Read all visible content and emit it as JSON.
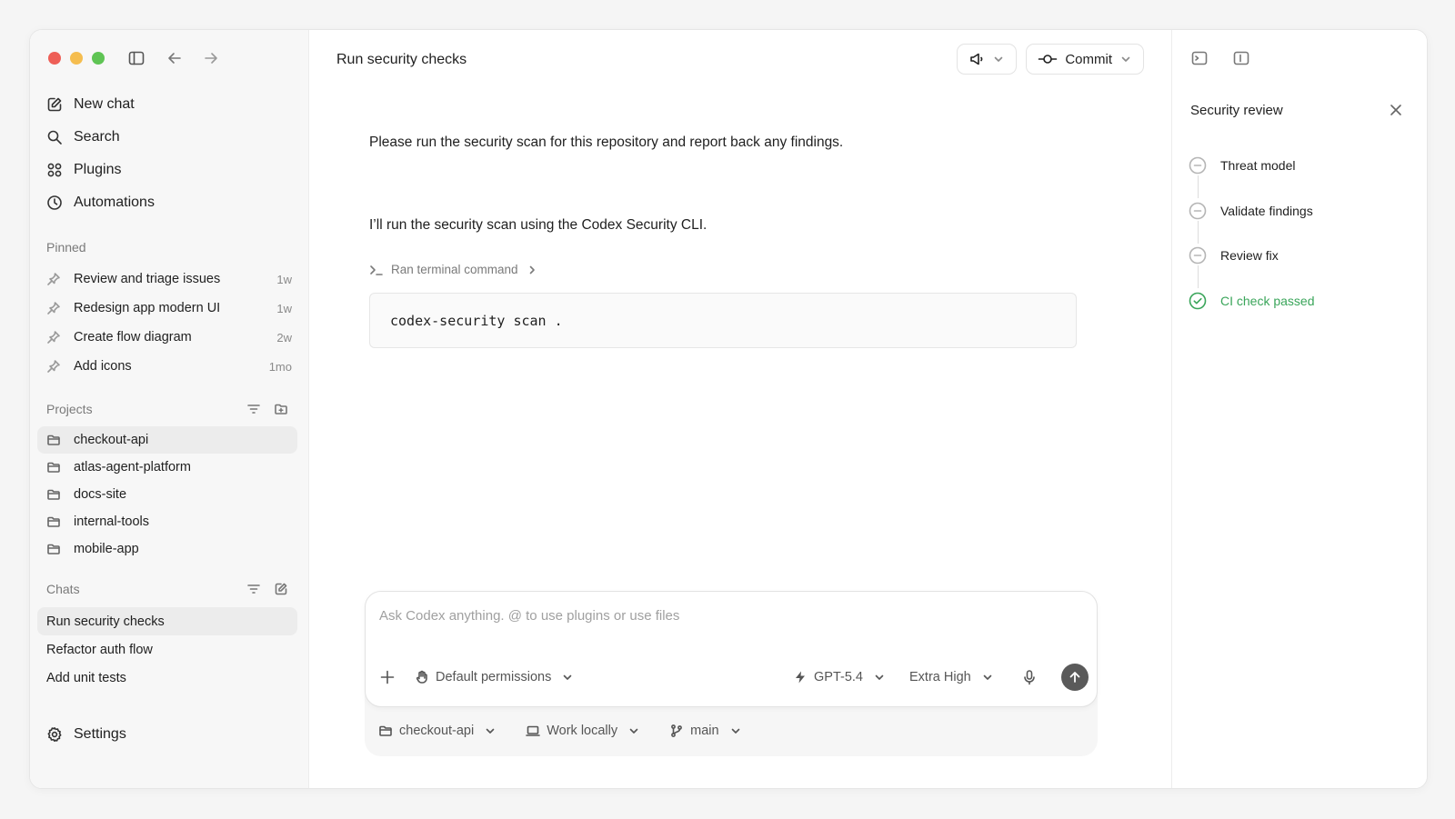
{
  "sidebar": {
    "nav": [
      {
        "label": "New chat",
        "icon": "new-chat-icon"
      },
      {
        "label": "Search",
        "icon": "search-icon"
      },
      {
        "label": "Plugins",
        "icon": "plugins-icon"
      },
      {
        "label": "Automations",
        "icon": "clock-icon"
      }
    ],
    "pinned_heading": "Pinned",
    "pinned": [
      {
        "label": "Review and triage issues",
        "age": "1w"
      },
      {
        "label": "Redesign app modern UI",
        "age": "1w"
      },
      {
        "label": "Create flow diagram",
        "age": "2w"
      },
      {
        "label": "Add icons",
        "age": "1mo"
      }
    ],
    "projects_heading": "Projects",
    "projects": [
      {
        "label": "checkout-api"
      },
      {
        "label": "atlas-agent-platform"
      },
      {
        "label": "docs-site"
      },
      {
        "label": "internal-tools"
      },
      {
        "label": "mobile-app"
      }
    ],
    "chats_heading": "Chats",
    "chats": [
      {
        "label": "Run security checks"
      },
      {
        "label": "Refactor auth flow"
      },
      {
        "label": "Add unit tests"
      }
    ],
    "settings_label": "Settings"
  },
  "main": {
    "title": "Run security checks",
    "commit_label": "Commit",
    "user_message": "Please run the security scan for this repository and report back any findings.",
    "assistant_message": "I’ll run the security scan using the Codex Security CLI.",
    "ran_command_label": "Ran terminal command",
    "code": "codex-security scan ."
  },
  "composer": {
    "placeholder": "Ask Codex anything. @ to use plugins or use files",
    "permissions_label": "Default permissions",
    "model_label": "GPT-5.4",
    "effort_label": "Extra High",
    "project_label": "checkout-api",
    "location_label": "Work locally",
    "branch_label": "main"
  },
  "right_panel": {
    "title": "Security review",
    "steps": [
      {
        "label": "Threat model",
        "status": "pending"
      },
      {
        "label": "Validate findings",
        "status": "pending"
      },
      {
        "label": "Review fix",
        "status": "pending"
      },
      {
        "label": "CI check passed",
        "status": "done"
      }
    ]
  },
  "colors": {
    "accent_green": "#3aa55a",
    "traffic_red": "#ee5f57",
    "traffic_yellow": "#f5bd4f",
    "traffic_green": "#5fc454"
  }
}
